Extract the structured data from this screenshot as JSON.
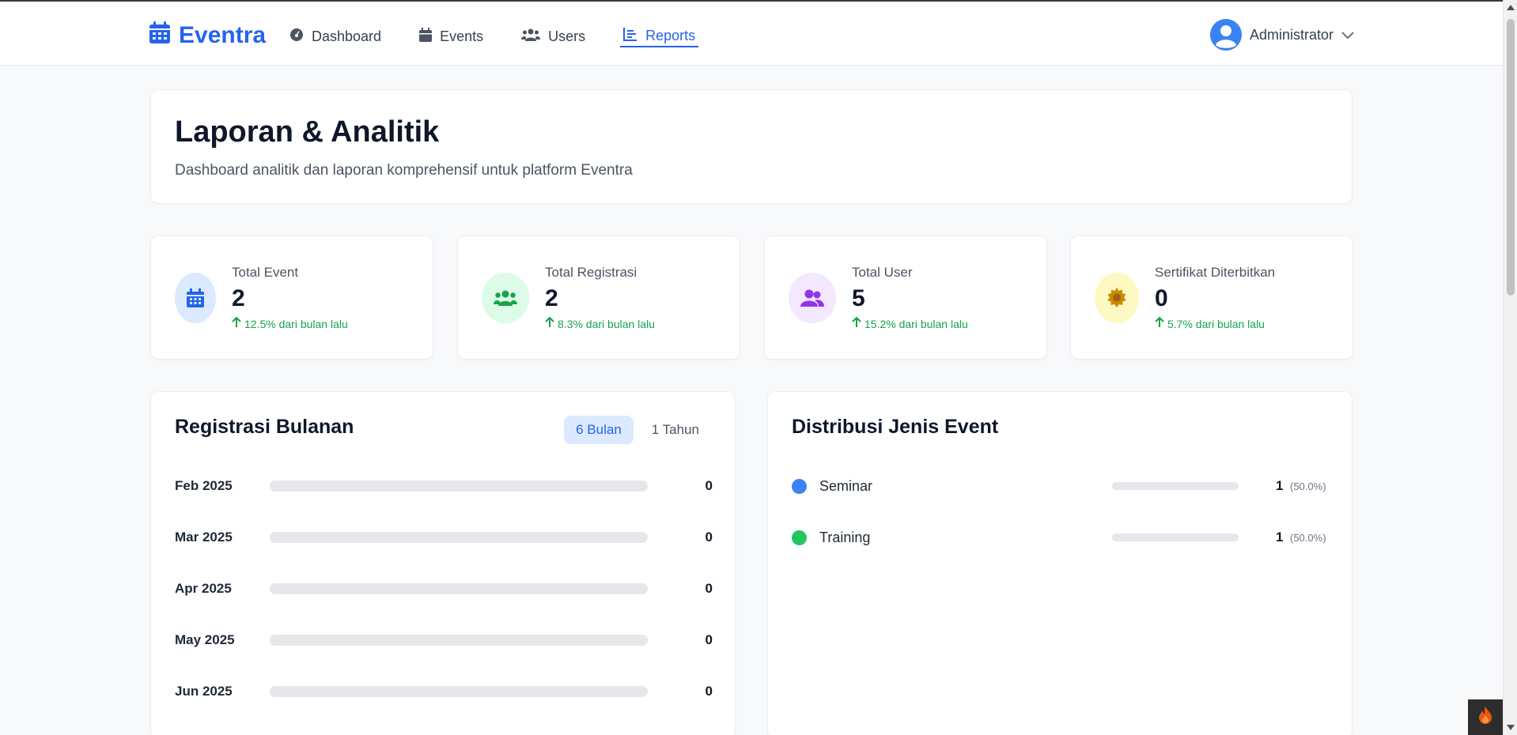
{
  "brand": {
    "name": "Eventra",
    "icon": "calendar-icon"
  },
  "nav": [
    {
      "label": "Dashboard",
      "icon": "gauge-icon",
      "active": false
    },
    {
      "label": "Events",
      "icon": "calendar-icon",
      "active": false
    },
    {
      "label": "Users",
      "icon": "users-icon",
      "active": false
    },
    {
      "label": "Reports",
      "icon": "chart-line-icon",
      "active": true
    }
  ],
  "user": {
    "name": "Administrator",
    "icon": "user-circle-icon",
    "chevron": "chevron-down-icon"
  },
  "header": {
    "title": "Laporan & Analitik",
    "subtitle": "Dashboard analitik dan laporan komprehensif untuk platform Eventra"
  },
  "stats": [
    {
      "label": "Total Event",
      "value": "2",
      "trend": "12.5% dari bulan lalu",
      "icon": "calendar-icon",
      "bg": "#dbeafe",
      "fg": "#2563eb"
    },
    {
      "label": "Total Registrasi",
      "value": "2",
      "trend": "8.3% dari bulan lalu",
      "icon": "users-icon",
      "bg": "#dcfce7",
      "fg": "#16a34a"
    },
    {
      "label": "Total User",
      "value": "5",
      "trend": "15.2% dari bulan lalu",
      "icon": "user-group-icon",
      "bg": "#f3e8ff",
      "fg": "#9333ea"
    },
    {
      "label": "Sertifikat Diterbitkan",
      "value": "0",
      "trend": "5.7% dari bulan lalu",
      "icon": "certificate-icon",
      "bg": "#fef9c3",
      "fg": "#ca8a04"
    }
  ],
  "monthly": {
    "title": "Registrasi Bulanan",
    "ranges": [
      {
        "label": "6 Bulan",
        "active": true
      },
      {
        "label": "1 Tahun",
        "active": false
      }
    ],
    "rows": [
      {
        "month": "Feb 2025",
        "value": 0
      },
      {
        "month": "Mar 2025",
        "value": 0
      },
      {
        "month": "Apr 2025",
        "value": 0
      },
      {
        "month": "May 2025",
        "value": 0
      },
      {
        "month": "Jun 2025",
        "value": 0
      }
    ]
  },
  "distribution": {
    "title": "Distribusi Jenis Event",
    "items": [
      {
        "label": "Seminar",
        "count": "1",
        "percent": "(50.0%)",
        "fraction": 0.5,
        "color": "#3b82f6"
      },
      {
        "label": "Training",
        "count": "1",
        "percent": "(50.0%)",
        "fraction": 0.5,
        "color": "#22c55e"
      }
    ]
  },
  "colors": {
    "accent": "#2563eb",
    "trend_up": "#16a34a"
  }
}
